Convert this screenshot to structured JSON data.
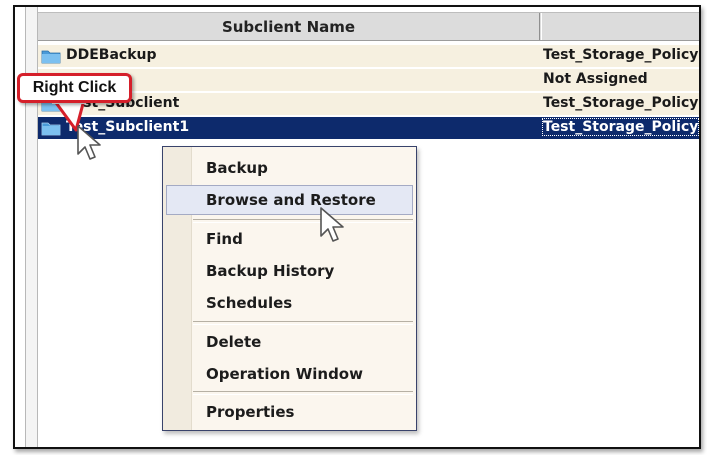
{
  "table": {
    "header": {
      "name_column": "Subclient Name"
    },
    "rows": [
      {
        "name": "DDEBackup",
        "policy": "Test_Storage_Policy",
        "selected": false
      },
      {
        "name": "",
        "policy": "Not Assigned",
        "selected": false
      },
      {
        "name": "Test_Subclient",
        "policy": "Test_Storage_Policy",
        "selected": false
      },
      {
        "name": "Test_Subclient1",
        "policy": "Test_Storage_Policy",
        "selected": true
      }
    ]
  },
  "context_menu": {
    "items": [
      {
        "label": "Backup"
      },
      {
        "label": "Browse and Restore",
        "highlighted": true
      },
      {
        "label": "Find"
      },
      {
        "label": "Backup History"
      },
      {
        "label": "Schedules"
      },
      {
        "label": "Delete"
      },
      {
        "label": "Operation Window"
      },
      {
        "label": "Properties"
      }
    ]
  },
  "callout": {
    "text": "Right Click",
    "border_color": "#d51f2a"
  },
  "colors": {
    "selected_row": "#0d2a6c",
    "row_background": "#f6f0e0",
    "header": "#dcdcdc"
  },
  "icons": {
    "folder": "folder-icon",
    "cursor": "mouse-pointer-icon"
  }
}
